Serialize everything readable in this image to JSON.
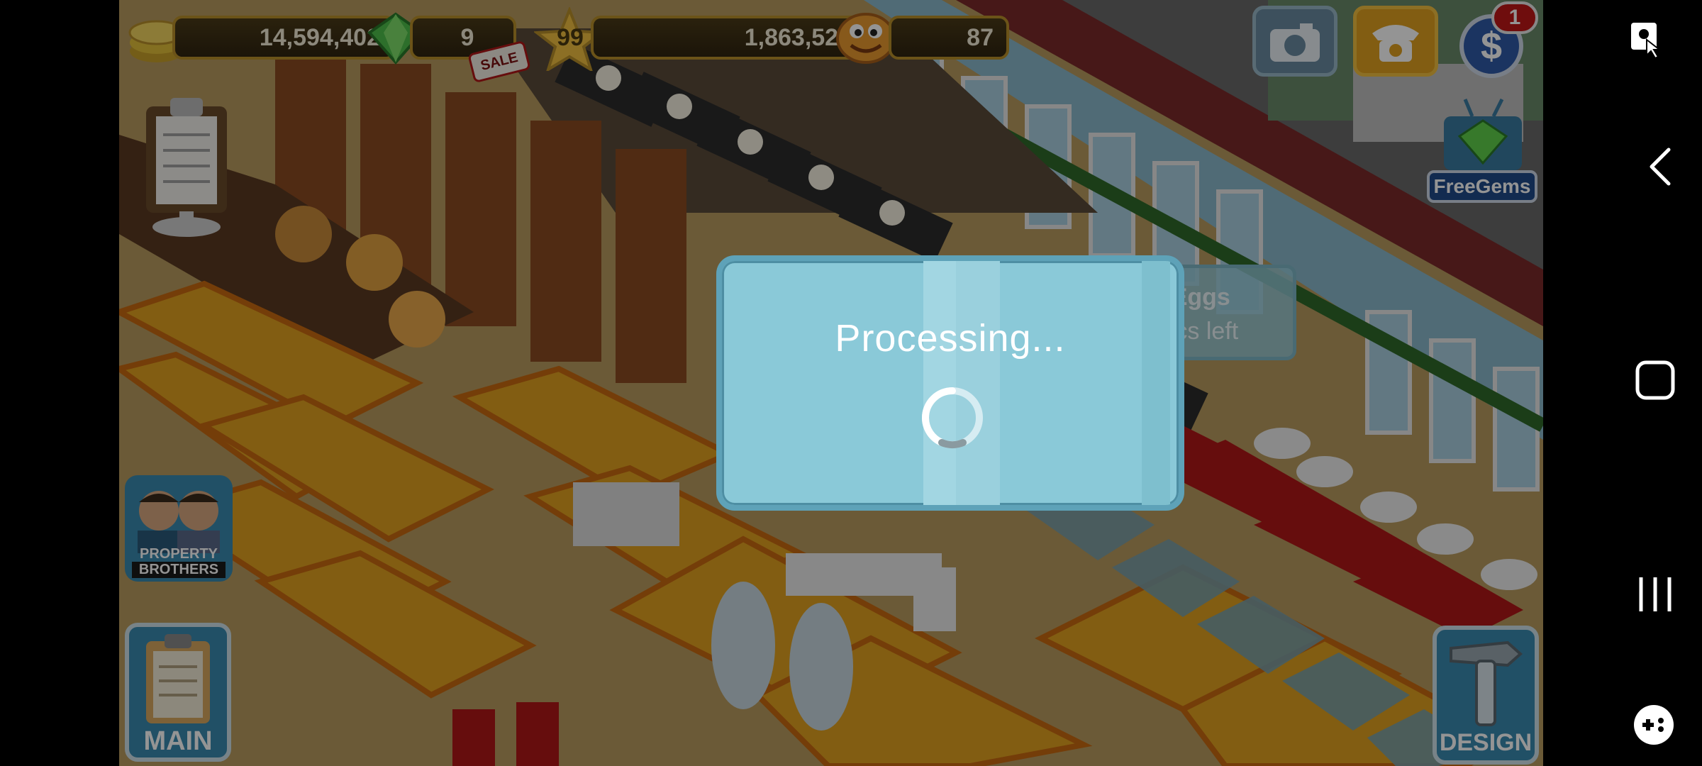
{
  "hud": {
    "coins": "14,594,402",
    "gems": "9",
    "sale_label": "SALE",
    "level": "99",
    "xp": "1,863,522",
    "mood": "87",
    "notification_count": "1"
  },
  "right_buttons": {
    "free_gems_label": "FreeGems"
  },
  "task_tooltip": {
    "title": "acon and Eggs",
    "time_left": "mins 14 secs left"
  },
  "dialog": {
    "title": "Processing..."
  },
  "left_buttons": {
    "promo_line1": "PROPERTY",
    "promo_line2": "BROTHERS",
    "main_label": "MAIN"
  },
  "design_button": {
    "label": "DESIGN"
  },
  "colors": {
    "dialog_bg": "#8ac9d8",
    "dialog_border": "#5ea2b8",
    "hud_border": "#b8902a"
  }
}
